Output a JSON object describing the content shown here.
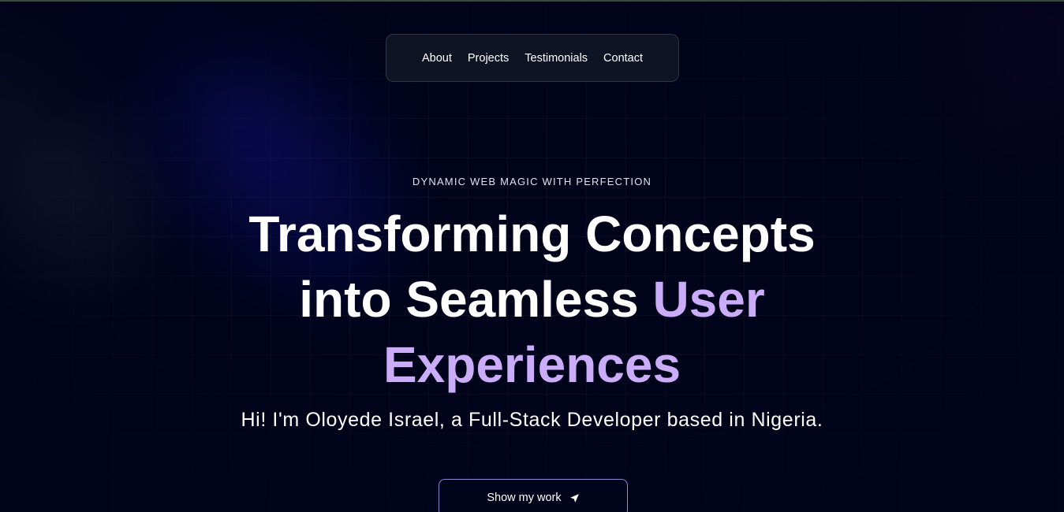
{
  "nav": {
    "items": [
      {
        "label": "About"
      },
      {
        "label": "Projects"
      },
      {
        "label": "Testimonials"
      },
      {
        "label": "Contact"
      }
    ]
  },
  "hero": {
    "tagline": "Dynamic Web Magic with Perfection",
    "headline_line1": "Transforming Concepts",
    "headline_line2_plain": "into Seamless ",
    "headline_line2_accent": "User",
    "headline_line3_accent": "Experiences",
    "intro": "Hi! I'm Oloyede Israel, a Full-Stack Developer based in Nigeria.",
    "cta_label": "Show my work",
    "cta_icon": "navigation-arrow-icon"
  },
  "colors": {
    "background": "#000319",
    "accent": "#cbacf9",
    "text": "#ffffff",
    "button_border": "#8a86cf"
  }
}
